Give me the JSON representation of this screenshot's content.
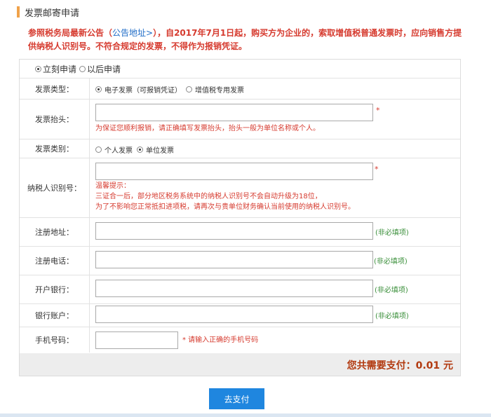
{
  "header": {
    "title": "发票邮寄申请"
  },
  "notice": {
    "prefix": "参照税务局最新公告（",
    "link": "公告地址>",
    "suffix": "），自2017年7月1日起，购买方为企业的，索取增值税普通发票时，应向销售方提供纳税人识别号。不符合规定的发票，不得作为报销凭证。"
  },
  "apply_mode": {
    "options": [
      {
        "label": "立刻申请",
        "selected": true
      },
      {
        "label": "以后申请",
        "selected": false
      }
    ]
  },
  "form": {
    "invoice_type": {
      "label": "发票类型：",
      "options": [
        {
          "label": "电子发票（可报销凭证）",
          "selected": true
        },
        {
          "label": "增值税专用发票",
          "selected": false
        }
      ]
    },
    "invoice_title": {
      "label": "发票抬头：",
      "value": "",
      "required_mark": "*",
      "hint": "为保证您顺利报销，请正确填写发票抬头，抬头一般为单位名称或个人。"
    },
    "invoice_category": {
      "label": "发票类别：",
      "options": [
        {
          "label": "个人发票",
          "selected": false
        },
        {
          "label": "单位发票",
          "selected": true
        }
      ]
    },
    "taxpayer_id": {
      "label": "纳税人识别号：",
      "value": "",
      "required_mark": "*",
      "hint_title": "温馨提示：",
      "hint_line1": "三证合一后，部分地区税务系统中的纳税人识别号不会自动升级为18位，",
      "hint_line2": "为了不影响您正常抵扣进项税，请再次与贵单位财务确认当前使用的纳税人识别号。"
    },
    "reg_address": {
      "label": "注册地址：",
      "value": "",
      "note": "(非必填项)"
    },
    "reg_phone": {
      "label": "注册电话：",
      "value": "",
      "note": "(非必填项)"
    },
    "bank_name": {
      "label": "开户银行：",
      "value": "",
      "note": "(非必填项)"
    },
    "bank_account": {
      "label": "银行账户：",
      "value": "",
      "note": "(非必填项)"
    },
    "mobile": {
      "label": "手机号码：",
      "value": "",
      "hint": "* 请输入正确的手机号码"
    }
  },
  "total": {
    "text": "您共需要支付：0.01 元"
  },
  "pay_button": {
    "label": "去支付"
  },
  "colors": {
    "accent_bar": "#f0a24a",
    "notice_red": "#d63b2f",
    "link_blue": "#1f6cc7",
    "optional_green": "#3a8f3a",
    "total_text": "#b23a10",
    "button_blue": "#1f86df"
  }
}
